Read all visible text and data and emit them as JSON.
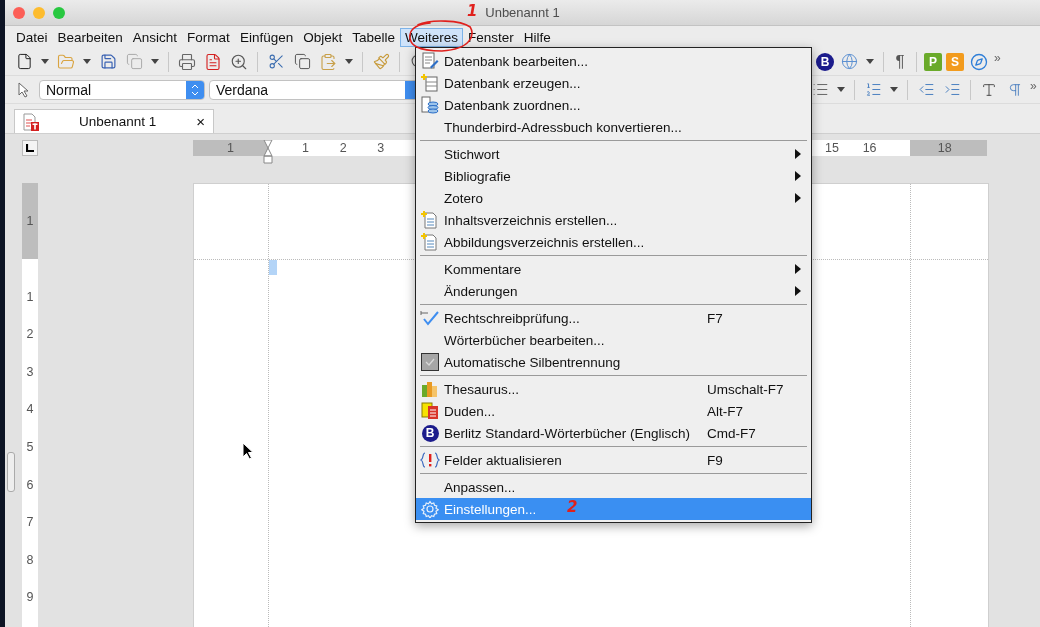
{
  "window": {
    "title": "Unbenannt 1"
  },
  "menu_bar": [
    {
      "label": "Datei",
      "selected": false
    },
    {
      "label": "Bearbeiten",
      "selected": false
    },
    {
      "label": "Ansicht",
      "selected": false
    },
    {
      "label": "Format",
      "selected": false
    },
    {
      "label": "Einfügen",
      "selected": false
    },
    {
      "label": "Objekt",
      "selected": false
    },
    {
      "label": "Tabelle",
      "selected": false
    },
    {
      "label": "Weiteres",
      "selected": true
    },
    {
      "label": "Fenster",
      "selected": false
    },
    {
      "label": "Hilfe",
      "selected": false
    }
  ],
  "standard_toolbar": {
    "badges": [
      {
        "label": "B",
        "color": "#1c1c8c"
      },
      {
        "label": "¶",
        "color": "#555555"
      },
      {
        "label": "P",
        "color": "#6aaa2a"
      },
      {
        "label": "S",
        "color": "#f29b1d"
      }
    ],
    "overflow": "»"
  },
  "format_toolbar": {
    "paragraph_style": "Normal",
    "font_name": "Verdana",
    "overflow": "»"
  },
  "document_tabs": [
    {
      "label": "Unbenannt 1",
      "selected": true,
      "close": "×"
    }
  ],
  "horizontal_ruler": {
    "labels": [
      "1",
      "1",
      "2",
      "3",
      "15",
      "16",
      "18"
    ]
  },
  "vertical_ruler": {
    "labels": [
      "1",
      "1",
      "2",
      "3",
      "4",
      "5",
      "6",
      "7",
      "8",
      "9"
    ]
  },
  "menu": {
    "groups": [
      [
        {
          "kind": "command",
          "label": "Datenbank bearbeiten...",
          "selected": false
        },
        {
          "kind": "command",
          "label": "Datenbank erzeugen...",
          "selected": false
        },
        {
          "kind": "command",
          "label": "Datenbank zuordnen...",
          "selected": false
        },
        {
          "kind": "command",
          "label": "Thunderbird-Adressbuch konvertieren...",
          "selected": false
        }
      ],
      [
        {
          "kind": "submenu",
          "label": "Stichwort",
          "selected": false
        },
        {
          "kind": "submenu",
          "label": "Bibliografie",
          "selected": false
        },
        {
          "kind": "submenu",
          "label": "Zotero",
          "selected": false
        },
        {
          "kind": "command",
          "label": "Inhaltsverzeichnis erstellen...",
          "selected": false
        },
        {
          "kind": "command",
          "label": "Abbildungsverzeichnis erstellen...",
          "selected": false
        }
      ],
      [
        {
          "kind": "submenu",
          "label": "Kommentare",
          "selected": false
        },
        {
          "kind": "submenu",
          "label": "Änderungen",
          "selected": false
        }
      ],
      [
        {
          "kind": "command",
          "label": "Rechtschreibprüfung...",
          "shortcut": "F7",
          "selected": false
        },
        {
          "kind": "command",
          "label": "Wörterbücher bearbeiten...",
          "selected": false
        },
        {
          "kind": "check",
          "label": "Automatische Silbentrennung",
          "checked": true,
          "selected": false
        }
      ],
      [
        {
          "kind": "command",
          "label": "Thesaurus...",
          "shortcut": "Umschalt-F7",
          "selected": false
        },
        {
          "kind": "command",
          "label": "Duden...",
          "shortcut": "Alt-F7",
          "selected": false
        },
        {
          "kind": "command",
          "label": "Berlitz Standard-Wörterbücher (Englisch)",
          "shortcut": "Cmd-F7",
          "badge": "B",
          "selected": false
        }
      ],
      [
        {
          "kind": "command",
          "label": "Felder aktualisieren",
          "shortcut": "F9",
          "selected": false
        }
      ],
      [
        {
          "kind": "command",
          "label": "Anpassen...",
          "selected": false
        },
        {
          "kind": "command",
          "label": "Einstellungen...",
          "selected": true
        }
      ]
    ]
  },
  "annotations": [
    {
      "label": "1"
    },
    {
      "label": "2"
    }
  ]
}
